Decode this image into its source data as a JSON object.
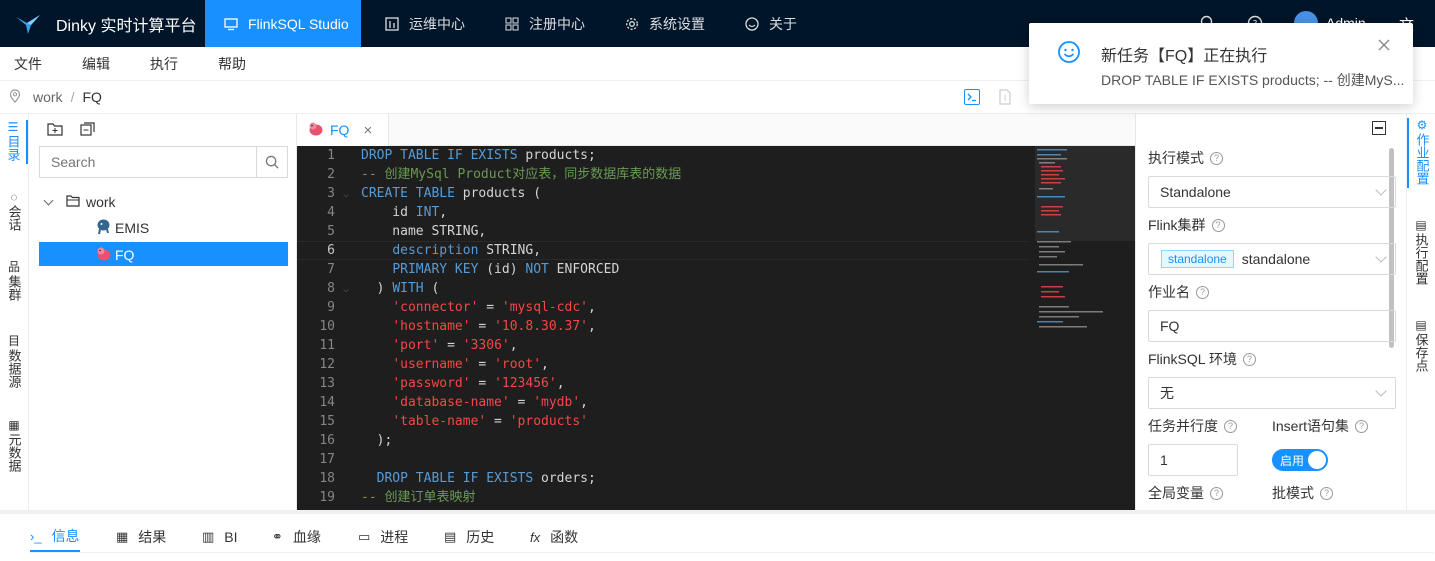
{
  "app": {
    "title": "Dinky 实时计算平台"
  },
  "nav": {
    "items": [
      {
        "label": "FlinkSQL Studio"
      },
      {
        "label": "运维中心"
      },
      {
        "label": "注册中心"
      },
      {
        "label": "系统设置"
      },
      {
        "label": "关于"
      }
    ],
    "user": "Admin",
    "lang_glyph": "文"
  },
  "menu": {
    "items": [
      "文件",
      "编辑",
      "执行",
      "帮助"
    ]
  },
  "breadcrumb": {
    "parts": [
      "work",
      "FQ"
    ],
    "sep": "/"
  },
  "left_rail": [
    {
      "label": "目录"
    },
    {
      "label": "会话"
    },
    {
      "label": "集群"
    },
    {
      "label": "数据源"
    },
    {
      "label": "元数据"
    }
  ],
  "tree": {
    "search_placeholder": "Search",
    "root": "work",
    "children": [
      "EMIS",
      "FQ"
    ]
  },
  "editor": {
    "tab_label": "FQ",
    "close_glyph": "×",
    "lines": [
      [
        [
          "kw",
          "DROP TABLE IF EXISTS "
        ],
        [
          "t",
          "products;"
        ]
      ],
      [
        [
          "cm",
          "-- 创建MySql Product对应表，同步数据库表的数据"
        ]
      ],
      [
        [
          "kw",
          "CREATE TABLE "
        ],
        [
          "t",
          "products ("
        ]
      ],
      [
        [
          "t",
          "    id "
        ],
        [
          "kw",
          "INT"
        ],
        [
          "t",
          ","
        ]
      ],
      [
        [
          "t",
          "    name STRING,"
        ]
      ],
      [
        [
          "t",
          "    "
        ],
        [
          "kw",
          "description"
        ],
        [
          "t",
          " STRING,"
        ]
      ],
      [
        [
          "t",
          "    "
        ],
        [
          "kw",
          "PRIMARY KEY"
        ],
        [
          "t",
          " (id) "
        ],
        [
          "kw",
          "NOT"
        ],
        [
          "t",
          " ENFORCED"
        ]
      ],
      [
        [
          "t",
          "  ) "
        ],
        [
          "kw",
          "WITH"
        ],
        [
          "t",
          " ("
        ]
      ],
      [
        [
          "t",
          "    "
        ],
        [
          "st",
          "'connector'"
        ],
        [
          "t",
          " = "
        ],
        [
          "st",
          "'mysql-cdc'"
        ],
        [
          "t",
          ","
        ]
      ],
      [
        [
          "t",
          "    "
        ],
        [
          "st",
          "'hostname'"
        ],
        [
          "t",
          " = "
        ],
        [
          "st",
          "'10.8.30.37'"
        ],
        [
          "t",
          ","
        ]
      ],
      [
        [
          "t",
          "    "
        ],
        [
          "st",
          "'port'"
        ],
        [
          "t",
          " = "
        ],
        [
          "st",
          "'3306'"
        ],
        [
          "t",
          ","
        ]
      ],
      [
        [
          "t",
          "    "
        ],
        [
          "st",
          "'username'"
        ],
        [
          "t",
          " = "
        ],
        [
          "st",
          "'root'"
        ],
        [
          "t",
          ","
        ]
      ],
      [
        [
          "t",
          "    "
        ],
        [
          "st",
          "'password'"
        ],
        [
          "t",
          " = "
        ],
        [
          "st",
          "'123456'"
        ],
        [
          "t",
          ","
        ]
      ],
      [
        [
          "t",
          "    "
        ],
        [
          "st",
          "'database-name'"
        ],
        [
          "t",
          " = "
        ],
        [
          "st",
          "'mydb'"
        ],
        [
          "t",
          ","
        ]
      ],
      [
        [
          "t",
          "    "
        ],
        [
          "st",
          "'table-name'"
        ],
        [
          "t",
          " = "
        ],
        [
          "st",
          "'products'"
        ]
      ],
      [
        [
          "t",
          "  );"
        ]
      ],
      [
        [
          "t",
          ""
        ]
      ],
      [
        [
          "t",
          "  "
        ],
        [
          "kw",
          "DROP TABLE IF EXISTS "
        ],
        [
          "t",
          "orders;"
        ]
      ],
      [
        [
          "cm",
          "-- 创建订单表映射"
        ]
      ]
    ]
  },
  "settings": {
    "exec_mode_label": "执行模式",
    "exec_mode_value": "Standalone",
    "cluster_label": "Flink集群",
    "cluster_tag": "standalone",
    "cluster_value": "standalone",
    "job_name_label": "作业名",
    "job_name_value": "FQ",
    "env_label": "FlinkSQL 环境",
    "env_value": "无",
    "parallelism_label": "任务并行度",
    "parallelism_value": "1",
    "insert_label": "Insert语句集",
    "insert_toggle": "启用",
    "global_var_label": "全局变量",
    "batch_label": "批模式"
  },
  "right_rail": [
    {
      "label": "作业配置"
    },
    {
      "label": "执行配置"
    },
    {
      "label": "保存点"
    }
  ],
  "bottom_tabs": [
    {
      "icon": "›_",
      "label": "信息"
    },
    {
      "icon": "▦",
      "label": "结果"
    },
    {
      "icon": "▥",
      "label": "BI"
    },
    {
      "icon": "⚭",
      "label": "血缘"
    },
    {
      "icon": "▭",
      "label": "进程"
    },
    {
      "icon": "▤",
      "label": "历史"
    },
    {
      "icon": "fx",
      "label": "函数"
    }
  ],
  "notification": {
    "title": "新任务【FQ】正在执行",
    "desc": "DROP TABLE IF EXISTS products; -- 创建MyS..."
  },
  "colors": {
    "brand": "#1890ff",
    "topbar": "#001529",
    "editor_bg": "#1e1e1e"
  }
}
